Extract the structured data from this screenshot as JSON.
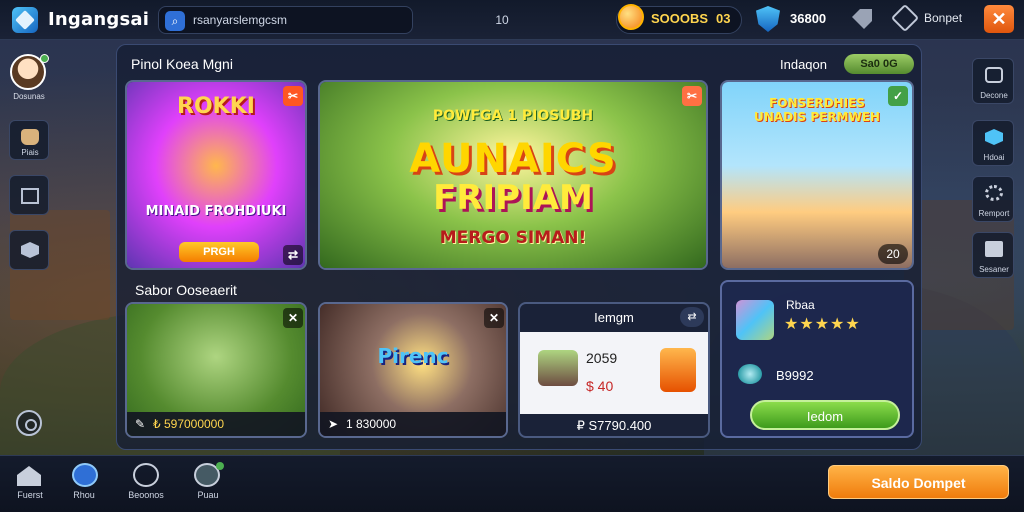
{
  "app": {
    "title": "Ingangsai"
  },
  "search": {
    "text": "rsanyarslemgcsm",
    "count": "10"
  },
  "currency": {
    "coins": "SOOOBS",
    "coins_extra": "03",
    "gems": "36800"
  },
  "user_label": "Bonpet",
  "close_label": "✕",
  "sidebar_left": {
    "avatar_label": "Dosunas",
    "items": [
      {
        "label": "Piais",
        "icon": "bag-icon"
      },
      {
        "label": "",
        "icon": "mail-icon"
      },
      {
        "label": "",
        "icon": "cube-icon"
      }
    ]
  },
  "sidebar_right": {
    "items": [
      {
        "label": "Decone",
        "icon": "camera-icon"
      },
      {
        "label": "Hdoai",
        "icon": "shield-icon"
      },
      {
        "label": "Remport",
        "icon": "gear-icon"
      },
      {
        "label": "Sesaner",
        "icon": "store-icon"
      }
    ]
  },
  "sections": {
    "featured_title": "Pinol Koea Mgni",
    "featured_right_title": "Indaqon",
    "badge": "Sa0 0G",
    "lower_title": "Sabor Ooseaerit"
  },
  "featured": [
    {
      "heading": "ROKKI",
      "subtitle": "MINAID FROHDIUKI",
      "button": "PRGH",
      "count": ""
    },
    {
      "top": "POWFGA 1 PIOSUBH",
      "heading": "AUNAICS",
      "heading2": "FRIPIAM",
      "subtitle": "MERGO SIMAN!"
    },
    {
      "top": "FONSERDHIES",
      "heading": "UNADIS PERMWEH",
      "count": "20"
    }
  ],
  "lower": [
    {
      "price": "₺ 597000000"
    },
    {
      "title": "Pirenc",
      "price": "1 830000"
    }
  ],
  "shop": {
    "title": "Iemgm",
    "value1": "2059",
    "value2": "$ 40",
    "price": "₽ S7790.400"
  },
  "reward": {
    "title": "Rbaa",
    "stars": "★★★★★",
    "value": "B9992",
    "button": "Iedom"
  },
  "bottom_nav": [
    {
      "label": "Fuerst",
      "icon": "home-icon"
    },
    {
      "label": "Rhou",
      "icon": "compass-icon"
    },
    {
      "label": "Beoonos",
      "icon": "grid-icon"
    },
    {
      "label": "Puau",
      "icon": "brush-icon"
    }
  ],
  "cta_label": "Saldo Dompet",
  "colors": {
    "accent_orange": "#f07c0c",
    "accent_green": "#558b2f",
    "panel": "#1a2238"
  }
}
